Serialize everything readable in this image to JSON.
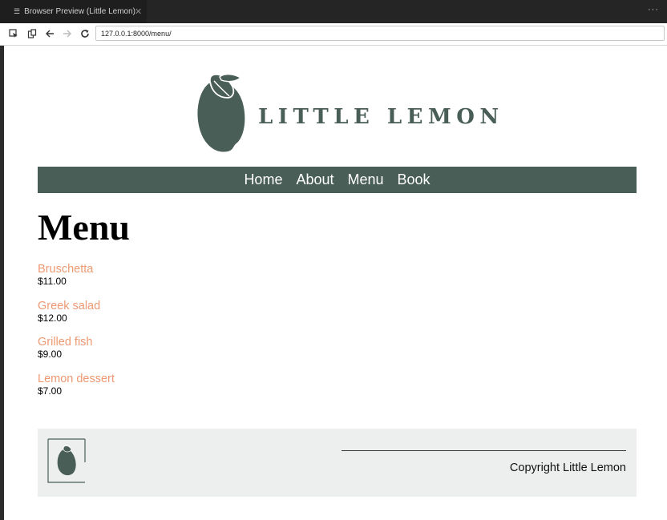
{
  "browser": {
    "tab_title": "Browser Preview (Little Lemon)",
    "close_glyph": "✕",
    "more_glyph": "···",
    "url": "127.0.0.1:8000/menu/"
  },
  "site": {
    "brand": "LITTLE LEMON",
    "brand_color": "#495e57",
    "nav": [
      "Home",
      "About",
      "Menu",
      "Book"
    ]
  },
  "page": {
    "title": "Menu",
    "items": [
      {
        "name": "Bruschetta",
        "price": "$11.00"
      },
      {
        "name": "Greek salad",
        "price": "$12.00"
      },
      {
        "name": "Grilled fish",
        "price": "$9.00"
      },
      {
        "name": "Lemon dessert",
        "price": "$7.00"
      }
    ],
    "item_name_color": "#ee9972"
  },
  "footer": {
    "copyright": "Copyright Little Lemon"
  }
}
